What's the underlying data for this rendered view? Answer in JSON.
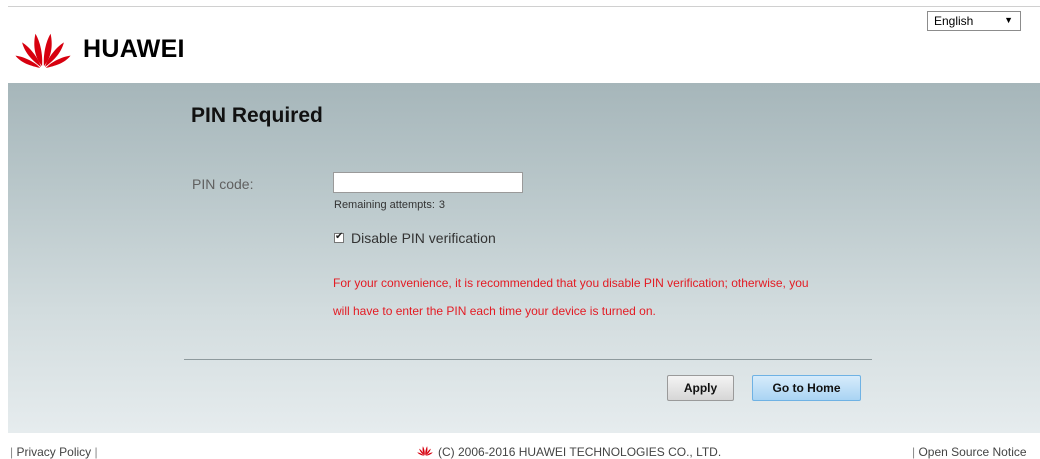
{
  "header": {
    "brand": "HUAWEI",
    "logo_icon": "huawei-petal-logo-icon",
    "language": {
      "selected": "English",
      "arrow": "▼"
    }
  },
  "main": {
    "title": "PIN Required",
    "pin_label": "PIN code:",
    "pin_value": "",
    "remaining_label": "Remaining attempts:",
    "remaining_count": "3",
    "disable_pin": {
      "label": "Disable PIN verification",
      "checked": true
    },
    "warning_line1": "For your convenience, it is recommended that you disable PIN verification; otherwise, you",
    "warning_line2": "will have to enter the PIN each time your device is turned on.",
    "warning_color": "#e31b23"
  },
  "buttons": {
    "apply": "Apply",
    "home": "Go to Home"
  },
  "footer": {
    "privacy": "Privacy Policy",
    "copyright": "(C) 2006-2016 HUAWEI TECHNOLOGIES CO., LTD.",
    "open_source": "Open Source Notice"
  }
}
